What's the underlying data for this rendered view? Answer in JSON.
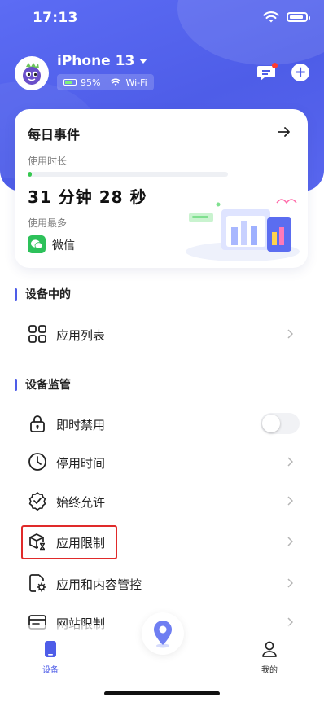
{
  "status_bar": {
    "time": "17:13"
  },
  "header": {
    "device_name": "iPhone 13",
    "battery_level": "95%",
    "network": "Wi-Fi"
  },
  "daily_card": {
    "title": "每日事件",
    "usage_label": "使用时长",
    "usage_progress_fraction": 0.02,
    "duration": "31 分钟 28 秒",
    "most_used_label": "使用最多",
    "most_used_app": "微信"
  },
  "sections": {
    "device": "设备中的",
    "supervision": "设备监管"
  },
  "menu": {
    "app_list": "应用列表",
    "instant_block": "即时禁用",
    "downtime": "停用时间",
    "always_allowed": "始终允许",
    "app_limits": "应用限制",
    "content_controls": "应用和内容管控",
    "website_limits": "网站限制"
  },
  "toggles": {
    "instant_block_on": false
  },
  "tabs": {
    "device": "设备",
    "mine": "我的"
  },
  "colors": {
    "primary": "#4e5de8",
    "accent_green": "#36c850",
    "highlight_red": "#e02a2a",
    "notification_dot": "#ff3b30"
  },
  "icons": {
    "app_list": "grid-icon",
    "instant_block": "lock-icon",
    "downtime": "clock-icon",
    "always_allowed": "badge-check-icon",
    "app_limits": "box-hourglass-icon",
    "content_controls": "gear-document-icon",
    "website_limits": "browser-icon"
  }
}
